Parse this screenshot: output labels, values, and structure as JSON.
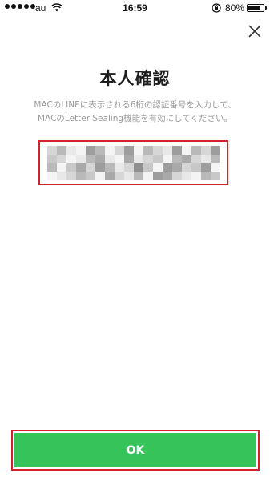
{
  "status_bar": {
    "carrier": "au",
    "time": "16:59",
    "battery_percent": "80%",
    "battery_level": 0.8,
    "icons": [
      "signal-dots",
      "wifi-icon",
      "rotation-lock-icon",
      "battery-icon"
    ]
  },
  "dialog": {
    "close_icon": "close-icon",
    "title": "本人確認",
    "instruction_line1": "MACのLINEに表示される6桁の認証番号を入力して、",
    "instruction_line2": "MACのLetter Sealing機能を有効にしてください。",
    "code_state": "pixelated"
  },
  "ok_button": {
    "label": "OK"
  },
  "colors": {
    "accent_green": "#36c35a",
    "highlight_red": "#d3222c",
    "hint_gray": "#9a9a9a"
  }
}
